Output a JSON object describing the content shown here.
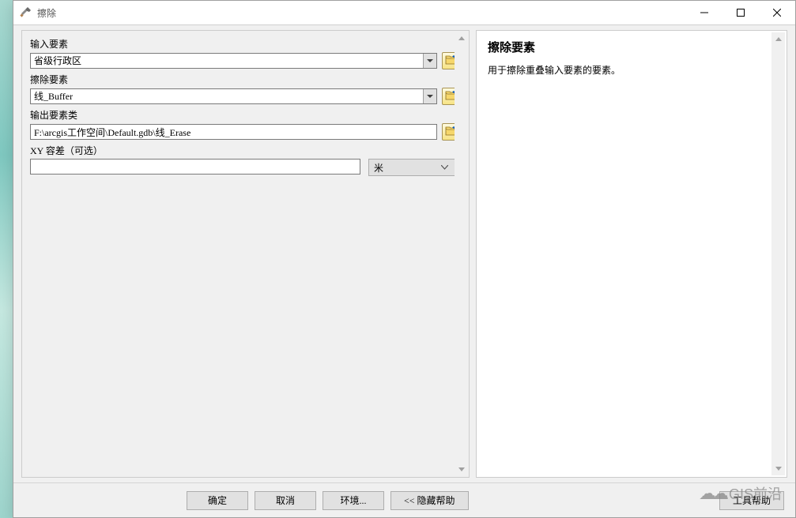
{
  "window": {
    "title": "擦除"
  },
  "form": {
    "input_features": {
      "label": "输入要素",
      "value": "省级行政区"
    },
    "erase_features": {
      "label": "擦除要素",
      "value": "线_Buffer"
    },
    "output_class": {
      "label": "输出要素类",
      "value": "F:\\arcgis工作空间\\Default.gdb\\线_Erase"
    },
    "tolerance": {
      "label": "XY 容差（可选）",
      "value": "",
      "unit": "米"
    }
  },
  "help": {
    "title": "擦除要素",
    "body": "用于擦除重叠输入要素的要素。"
  },
  "buttons": {
    "ok": "确定",
    "cancel": "取消",
    "environments": "环境...",
    "hide_help": "<< 隐藏帮助",
    "tool_help": "工具帮助"
  },
  "watermark": "GIS前沿"
}
